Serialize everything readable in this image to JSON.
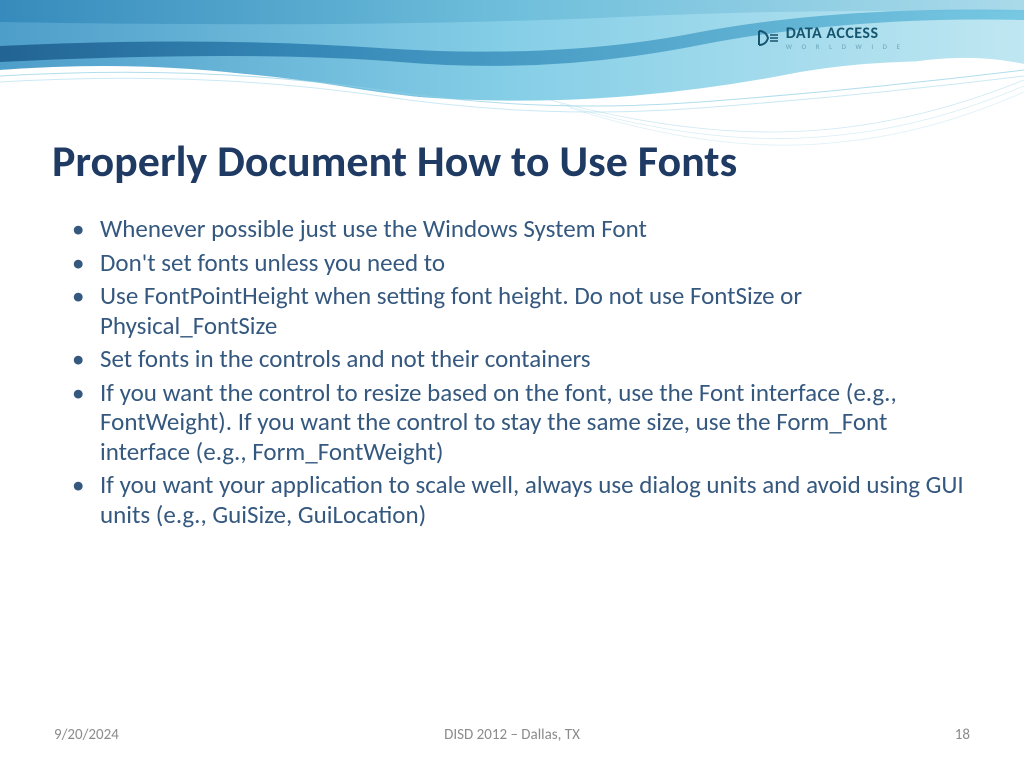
{
  "logo": {
    "main": "DATA ACCESS",
    "sub": "W O R L D W I D E"
  },
  "title": "Properly Document How to Use Fonts",
  "bullets": [
    "Whenever possible just use the Windows System Font",
    "Don't set fonts unless you need to",
    "Use FontPointHeight when setting font height. Do not use FontSize or Physical_FontSize",
    "Set fonts in the controls and not their containers",
    "If you want the control to resize based on the font, use the Font interface (e.g., FontWeight). If you want the control to stay the same size, use the Form_Font interface (e.g., Form_FontWeight)",
    "If you want your application to scale well, always use dialog units and avoid using GUI units (e.g., GuiSize, GuiLocation)"
  ],
  "footer": {
    "date": "9/20/2024",
    "event": "DISD 2012 – Dallas, TX",
    "page": "18"
  }
}
